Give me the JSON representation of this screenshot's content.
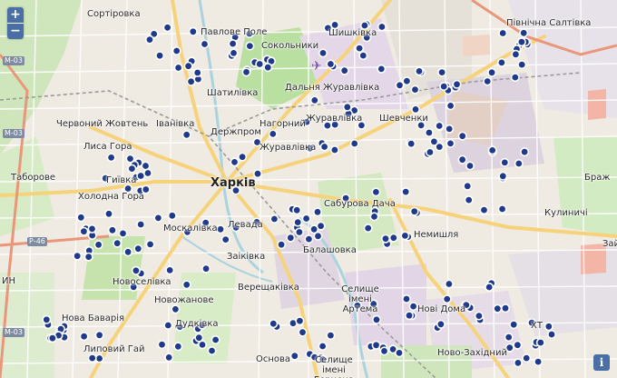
{
  "controls": {
    "zoom_in": "+",
    "zoom_out": "−",
    "info": "i"
  },
  "labels": [
    "Сортіровка",
    "Павлове Поле",
    "Сокольники",
    "Шишківка",
    "Північна Салтівка",
    "Дальня Журавлівка",
    "Шатилівка",
    "Іванівка",
    "Нагорний",
    "Журавлівка",
    "Шевченки",
    "Червоний Жовтень",
    "Держпром",
    "Журавлівка",
    "Лиса Гора",
    "Таборове",
    "Гиївка",
    "Холодна Гора",
    "Харків",
    "Сабурова Дача",
    "Кулиничі",
    "Браж",
    "Левада",
    "Немишля",
    "Москалівка",
    "Зай",
    "Заіківка",
    "Балашовка",
    "Новоселівка",
    "Новожанове",
    "Верещаківка",
    "Селище імені Артема",
    "Нові Дома",
    "Нова Баварія",
    "Дудківка",
    "ХТ",
    "Липовий Гай",
    "Основа",
    "Ново-Західний",
    "Селище імені Герцена",
    "ИН"
  ],
  "road_shields": [
    "М-03",
    "М-03",
    "Р-46",
    "М-03"
  ],
  "colors": {
    "marker": "#1f3a8a",
    "marker_halo": "#ffffff",
    "controls": "#4a6fa5"
  },
  "marker_count": 260
}
